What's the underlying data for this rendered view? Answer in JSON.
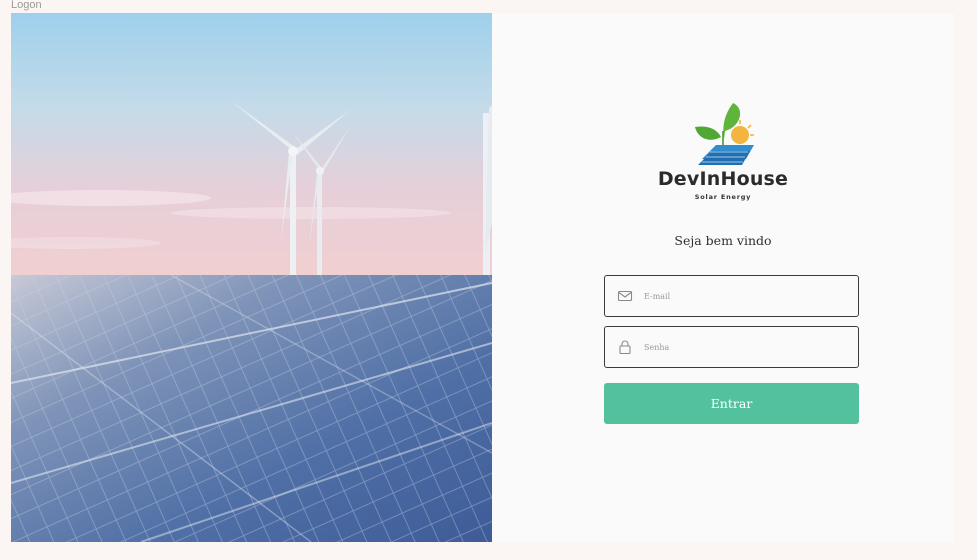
{
  "window": {
    "tab_title": "Logon"
  },
  "hero": {
    "image": "wind-turbines-and-solar-panels"
  },
  "brand": {
    "name": "DevInHouse",
    "tagline": "Solar Energy",
    "icon": "leaf-sun-solar-panel-logo"
  },
  "login": {
    "greeting": "Seja bem vindo",
    "email": {
      "placeholder": "E-mail",
      "value": "",
      "icon": "mail-icon"
    },
    "password": {
      "placeholder": "Senha",
      "value": "",
      "icon": "lock-icon"
    },
    "submit_label": "Entrar"
  },
  "colors": {
    "accent": "#53c19d",
    "page_background": "#fbf5f3",
    "panel_background": "#fafafa",
    "field_border": "#3b3b3b"
  }
}
